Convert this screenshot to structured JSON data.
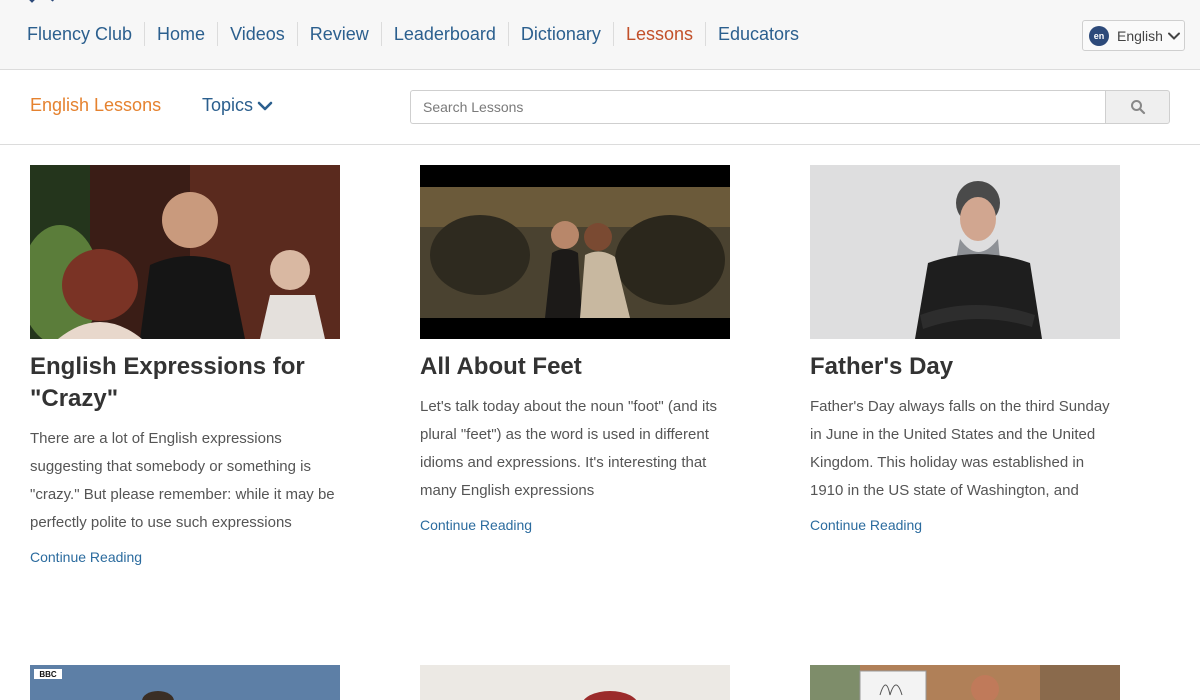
{
  "topnav": {
    "links": [
      "Fluency Club",
      "Home",
      "Videos",
      "Review",
      "Leaderboard",
      "Dictionary",
      "Lessons",
      "Educators"
    ],
    "active_index": 6,
    "language": {
      "badge": "en",
      "label": "English"
    }
  },
  "subheader": {
    "title": "English Lessons",
    "topics_label": "Topics",
    "search_placeholder": "Search Lessons"
  },
  "lessons": [
    {
      "title": "English Expressions for \"Crazy\"",
      "excerpt": "There are a lot of English expressions suggesting that somebody or something is \"crazy.\" But please remember: while it may be perfectly polite to use such expressions",
      "link": "Continue Reading"
    },
    {
      "title": "All About Feet",
      "excerpt": "Let's talk today about the noun \"foot\" (and its plural \"feet\") as the word is used in different idioms and expressions. It's interesting that many English expressions",
      "link": "Continue Reading"
    },
    {
      "title": "Father's Day",
      "excerpt": "Father's Day always falls on the third Sunday in June in the United States and the United Kingdom. This holiday was established in 1910 in the US state of Washington, and",
      "link": "Continue Reading"
    }
  ],
  "second_row": {
    "first_thumb_tag": "BBC"
  },
  "colors": {
    "link": "#2b5f8e",
    "active": "#c2502a",
    "accent": "#e5822f"
  },
  "icons": {
    "search": "search-icon",
    "chevron": "chevron-down-icon"
  }
}
